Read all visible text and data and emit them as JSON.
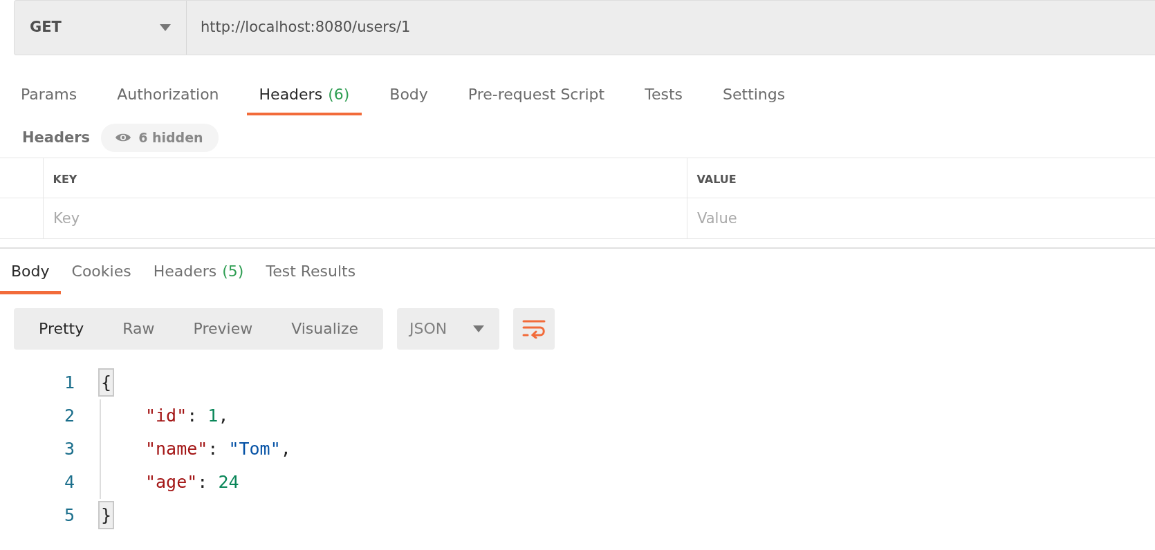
{
  "request": {
    "method": "GET",
    "url": "http://localhost:8080/users/1"
  },
  "request_tabs": [
    {
      "label": "Params",
      "selected": false
    },
    {
      "label": "Authorization",
      "selected": false
    },
    {
      "label": "Headers",
      "count": "(6)",
      "selected": true
    },
    {
      "label": "Body",
      "selected": false
    },
    {
      "label": "Pre-request Script",
      "selected": false
    },
    {
      "label": "Tests",
      "selected": false
    },
    {
      "label": "Settings",
      "selected": false
    }
  ],
  "headers_section": {
    "title": "Headers",
    "hidden_toggle": "6 hidden"
  },
  "headers_table": {
    "columns": [
      "KEY",
      "VALUE"
    ],
    "new_row": {
      "key_placeholder": "Key",
      "value_placeholder": "Value"
    }
  },
  "response_tabs": [
    {
      "label": "Body",
      "selected": true
    },
    {
      "label": "Cookies",
      "selected": false
    },
    {
      "label": "Headers",
      "count": "(5)",
      "selected": false
    },
    {
      "label": "Test Results",
      "selected": false
    }
  ],
  "view_modes": [
    {
      "label": "Pretty",
      "selected": true
    },
    {
      "label": "Raw",
      "selected": false
    },
    {
      "label": "Preview",
      "selected": false
    },
    {
      "label": "Visualize",
      "selected": false
    }
  ],
  "format_select": "JSON",
  "code_lines": [
    {
      "number": "1",
      "indented": false,
      "tokens": [
        {
          "kind": "brace",
          "text": "{",
          "matched": true
        }
      ]
    },
    {
      "number": "2",
      "indented": true,
      "tokens": [
        {
          "kind": "key",
          "text": "\"id\""
        },
        {
          "kind": "punct",
          "text": ": "
        },
        {
          "kind": "number",
          "text": "1"
        },
        {
          "kind": "punct",
          "text": ","
        }
      ]
    },
    {
      "number": "3",
      "indented": true,
      "tokens": [
        {
          "kind": "key",
          "text": "\"name\""
        },
        {
          "kind": "punct",
          "text": ": "
        },
        {
          "kind": "string",
          "text": "\"Tom\""
        },
        {
          "kind": "punct",
          "text": ","
        }
      ]
    },
    {
      "number": "4",
      "indented": true,
      "tokens": [
        {
          "kind": "key",
          "text": "\"age\""
        },
        {
          "kind": "punct",
          "text": ": "
        },
        {
          "kind": "number",
          "text": "24"
        }
      ]
    },
    {
      "number": "5",
      "indented": false,
      "tokens": [
        {
          "kind": "brace",
          "text": "}",
          "matched": true
        }
      ]
    }
  ]
}
